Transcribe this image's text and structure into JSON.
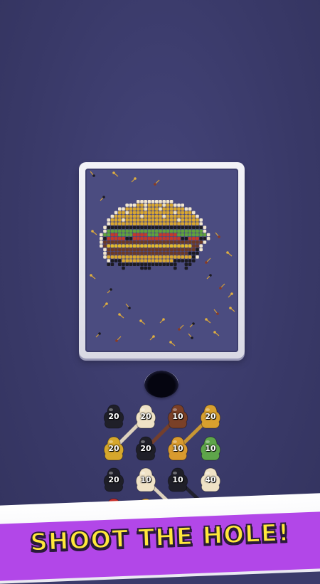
{
  "banner": {
    "text": "SHOOT THE HOLE!"
  },
  "board": {
    "picture": "hamburger-pixel-art",
    "colors": {
      "bun": "#d9a730",
      "bun_highlight": "#f2e3b8",
      "outline": "#f1e6cf",
      "lettuce": "#5fa23c",
      "tomato": "#c43a2a",
      "cheese": "#e2b92c",
      "patty": "#6b3a26",
      "dark": "#1c1b22",
      "board_bg": "#4b4c80"
    }
  },
  "hole": {
    "icon": "black-hole"
  },
  "shooters": [
    {
      "count": "20",
      "color": "#1f1f28"
    },
    {
      "count": "20",
      "color": "#efe2c6"
    },
    {
      "count": "10",
      "color": "#7a4027"
    },
    {
      "count": "20",
      "color": "#d8a02e"
    },
    {
      "count": "20",
      "color": "#d6a72c"
    },
    {
      "count": "20",
      "color": "#1f1f28"
    },
    {
      "count": "10",
      "color": "#d89a2e"
    },
    {
      "count": "10",
      "color": "#5ea54a"
    },
    {
      "count": "20",
      "color": "#1f1f28"
    },
    {
      "count": "10",
      "color": "#efe2c6"
    },
    {
      "count": "10",
      "color": "#1f1f28"
    },
    {
      "count": "40",
      "color": "#efe2c6"
    },
    {
      "count": "",
      "color": "#c9302c"
    },
    {
      "count": "",
      "color": "#d8a02e"
    },
    {
      "count": "",
      "color": "#d8a02e"
    },
    {
      "count": "",
      "color": "#e0c64a"
    }
  ]
}
